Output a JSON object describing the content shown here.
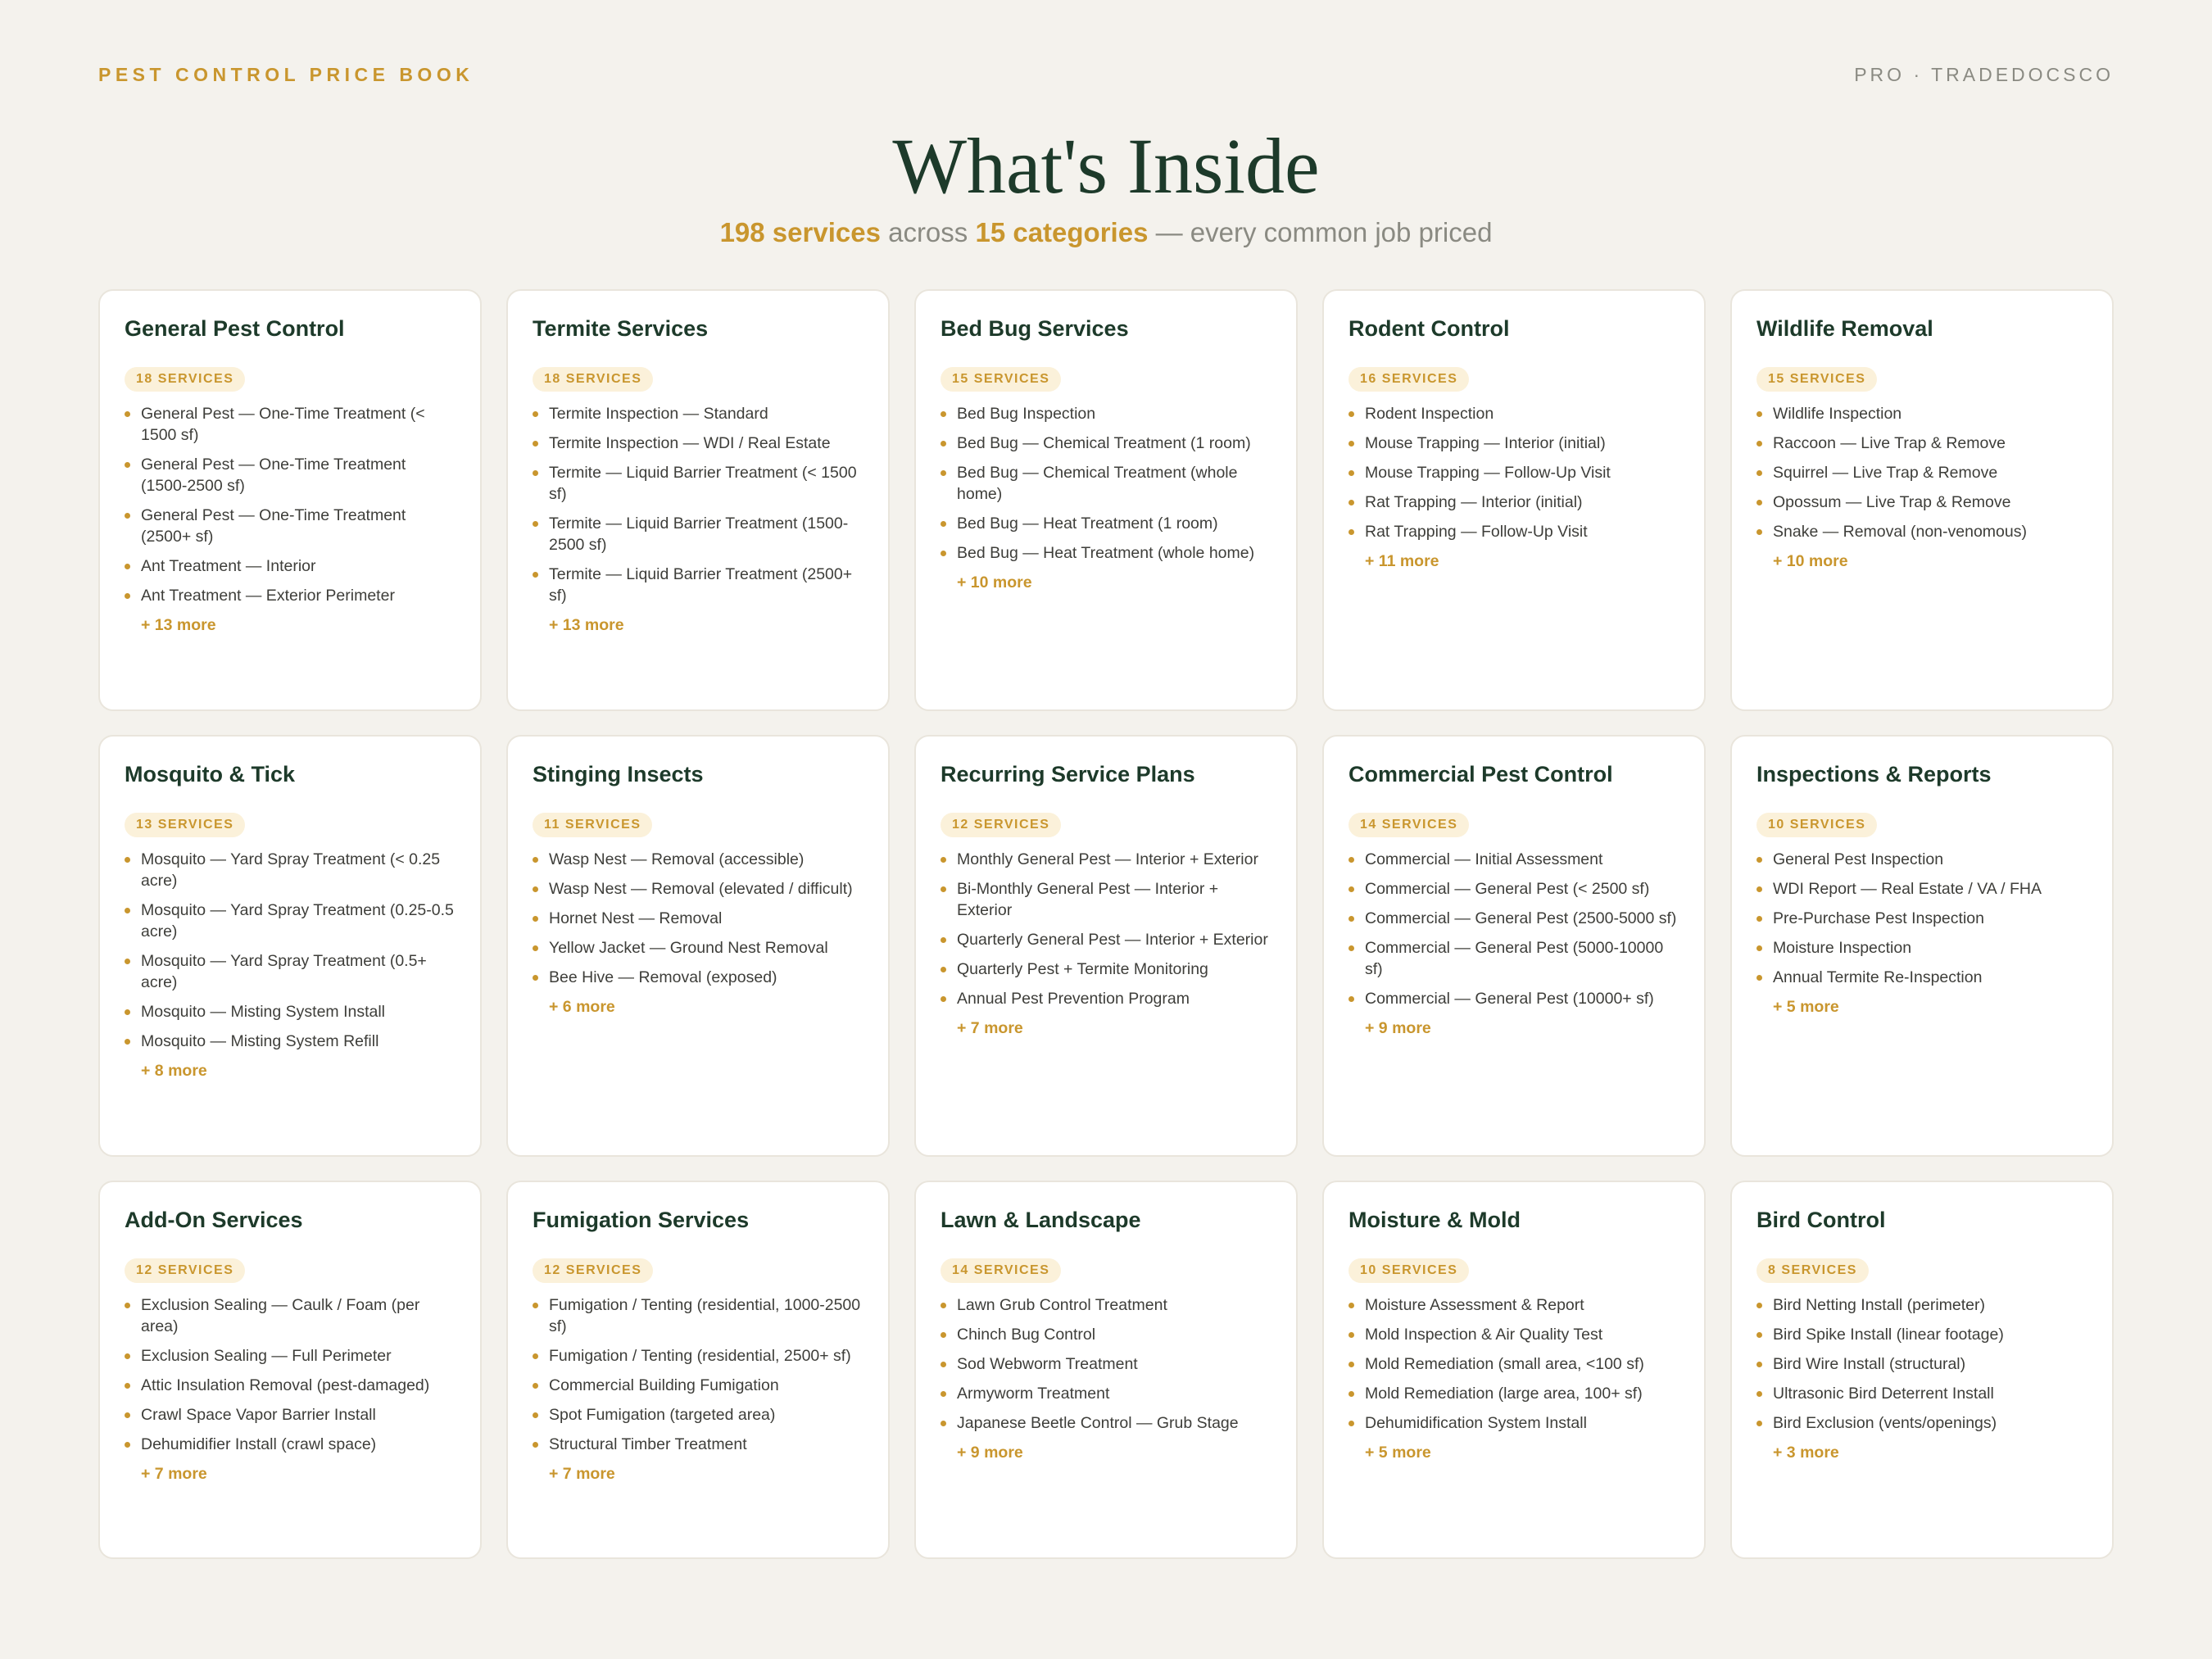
{
  "header": {
    "brand": "PEST CONTROL PRICE BOOK",
    "tagline": "PRO · TRADEDOCSCO"
  },
  "title": "What's Inside",
  "subtitle": {
    "services": "198 services",
    "across": " across ",
    "categories": "15 categories",
    "rest": " — every common job priced"
  },
  "categories": [
    {
      "title": "General Pest Control",
      "badge": "18 SERVICES",
      "items": [
        "General Pest — One-Time Treatment (< 1500 sf)",
        "General Pest — One-Time Treatment (1500-2500 sf)",
        "General Pest — One-Time Treatment (2500+ sf)",
        "Ant Treatment — Interior",
        "Ant Treatment — Exterior Perimeter"
      ],
      "more": "+ 13 more"
    },
    {
      "title": "Termite Services",
      "badge": "18 SERVICES",
      "items": [
        "Termite Inspection — Standard",
        "Termite Inspection — WDI / Real Estate",
        "Termite — Liquid Barrier Treatment (< 1500 sf)",
        "Termite — Liquid Barrier Treatment (1500-2500 sf)",
        "Termite — Liquid Barrier Treatment (2500+ sf)"
      ],
      "more": "+ 13 more"
    },
    {
      "title": "Bed Bug Services",
      "badge": "15 SERVICES",
      "items": [
        "Bed Bug Inspection",
        "Bed Bug — Chemical Treatment (1 room)",
        "Bed Bug — Chemical Treatment (whole home)",
        "Bed Bug — Heat Treatment (1 room)",
        "Bed Bug — Heat Treatment (whole home)"
      ],
      "more": "+ 10 more"
    },
    {
      "title": "Rodent Control",
      "badge": "16 SERVICES",
      "items": [
        "Rodent Inspection",
        "Mouse Trapping — Interior (initial)",
        "Mouse Trapping — Follow-Up Visit",
        "Rat Trapping — Interior (initial)",
        "Rat Trapping — Follow-Up Visit"
      ],
      "more": "+ 11 more"
    },
    {
      "title": "Wildlife Removal",
      "badge": "15 SERVICES",
      "items": [
        "Wildlife Inspection",
        "Raccoon — Live Trap & Remove",
        "Squirrel — Live Trap & Remove",
        "Opossum — Live Trap & Remove",
        "Snake — Removal (non-venomous)"
      ],
      "more": "+ 10 more"
    },
    {
      "title": "Mosquito & Tick",
      "badge": "13 SERVICES",
      "items": [
        "Mosquito — Yard Spray Treatment (< 0.25 acre)",
        "Mosquito — Yard Spray Treatment (0.25-0.5 acre)",
        "Mosquito — Yard Spray Treatment (0.5+ acre)",
        "Mosquito — Misting System Install",
        "Mosquito — Misting System Refill"
      ],
      "more": "+ 8 more"
    },
    {
      "title": "Stinging Insects",
      "badge": "11 SERVICES",
      "items": [
        "Wasp Nest — Removal (accessible)",
        "Wasp Nest — Removal (elevated / difficult)",
        "Hornet Nest — Removal",
        "Yellow Jacket — Ground Nest Removal",
        "Bee Hive — Removal (exposed)"
      ],
      "more": "+ 6 more"
    },
    {
      "title": "Recurring Service Plans",
      "badge": "12 SERVICES",
      "items": [
        "Monthly General Pest — Interior + Exterior",
        "Bi-Monthly General Pest — Interior + Exterior",
        "Quarterly General Pest — Interior + Exterior",
        "Quarterly Pest + Termite Monitoring",
        "Annual Pest Prevention Program"
      ],
      "more": "+ 7 more"
    },
    {
      "title": "Commercial Pest Control",
      "badge": "14 SERVICES",
      "items": [
        "Commercial — Initial Assessment",
        "Commercial — General Pest (< 2500 sf)",
        "Commercial — General Pest (2500-5000 sf)",
        "Commercial — General Pest (5000-10000 sf)",
        "Commercial — General Pest (10000+ sf)"
      ],
      "more": "+ 9 more"
    },
    {
      "title": "Inspections & Reports",
      "badge": "10 SERVICES",
      "items": [
        "General Pest Inspection",
        "WDI Report — Real Estate / VA / FHA",
        "Pre-Purchase Pest Inspection",
        "Moisture Inspection",
        "Annual Termite Re-Inspection"
      ],
      "more": "+ 5 more"
    },
    {
      "title": "Add-On Services",
      "badge": "12 SERVICES",
      "items": [
        "Exclusion Sealing — Caulk / Foam (per area)",
        "Exclusion Sealing — Full Perimeter",
        "Attic Insulation Removal (pest-damaged)",
        "Crawl Space Vapor Barrier Install",
        "Dehumidifier Install (crawl space)"
      ],
      "more": "+ 7 more"
    },
    {
      "title": "Fumigation Services",
      "badge": "12 SERVICES",
      "items": [
        "Fumigation / Tenting (residential, 1000-2500 sf)",
        "Fumigation / Tenting (residential, 2500+ sf)",
        "Commercial Building Fumigation",
        "Spot Fumigation (targeted area)",
        "Structural Timber Treatment"
      ],
      "more": "+ 7 more"
    },
    {
      "title": "Lawn & Landscape",
      "badge": "14 SERVICES",
      "items": [
        "Lawn Grub Control Treatment",
        "Chinch Bug Control",
        "Sod Webworm Treatment",
        "Armyworm Treatment",
        "Japanese Beetle Control — Grub Stage"
      ],
      "more": "+ 9 more"
    },
    {
      "title": "Moisture & Mold",
      "badge": "10 SERVICES",
      "items": [
        "Moisture Assessment & Report",
        "Mold Inspection & Air Quality Test",
        "Mold Remediation (small area, <100 sf)",
        "Mold Remediation (large area, 100+ sf)",
        "Dehumidification System Install"
      ],
      "more": "+ 5 more"
    },
    {
      "title": "Bird Control",
      "badge": "8 SERVICES",
      "items": [
        "Bird Netting Install (perimeter)",
        "Bird Spike Install (linear footage)",
        "Bird Wire Install (structural)",
        "Ultrasonic Bird Deterrent Install",
        "Bird Exclusion (vents/openings)"
      ],
      "more": "+ 3 more"
    }
  ]
}
